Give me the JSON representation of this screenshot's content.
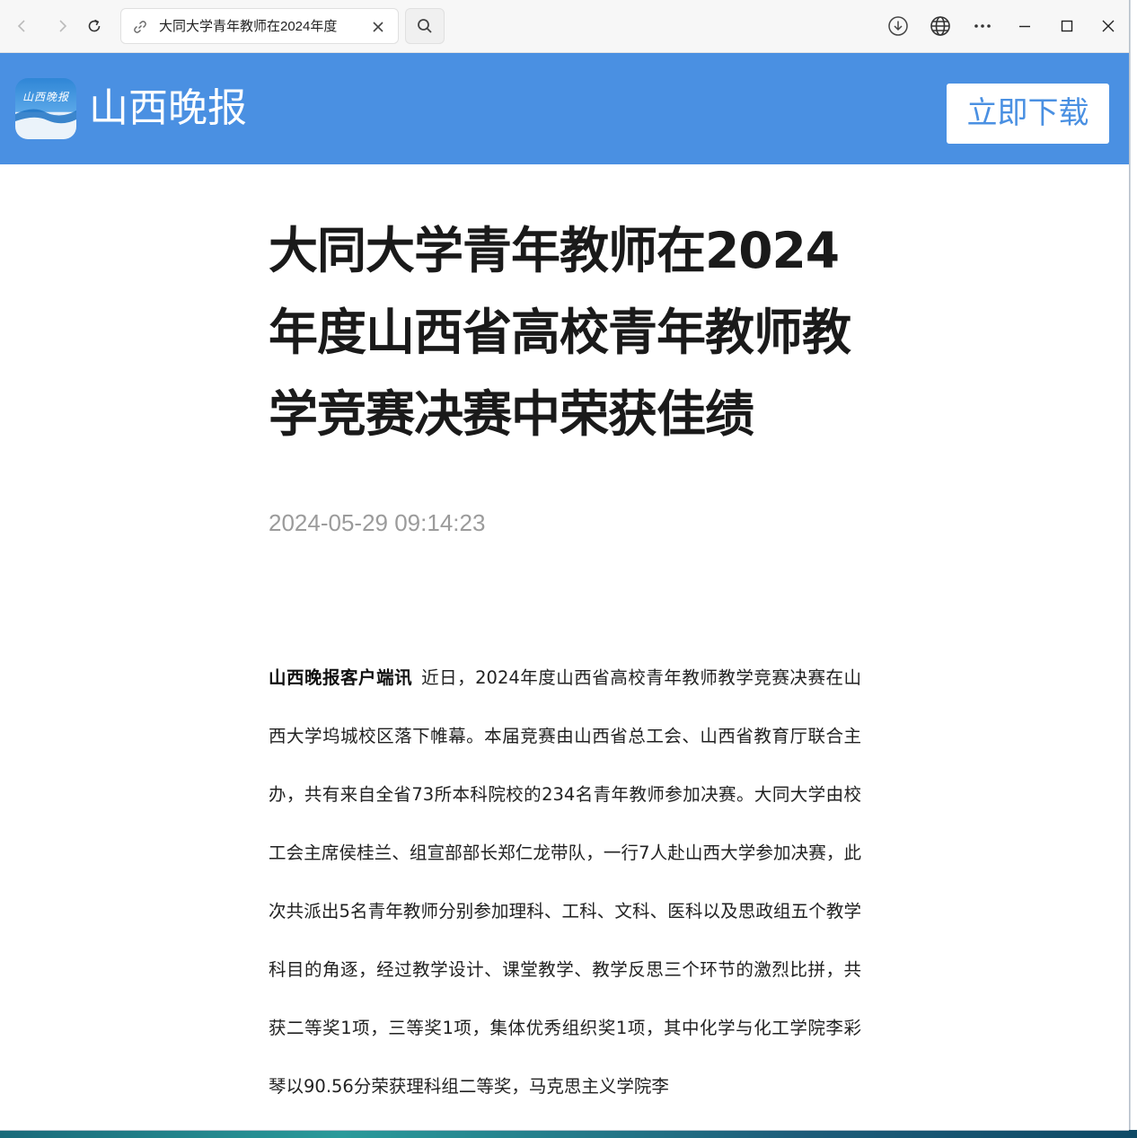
{
  "browser": {
    "tab_title": "大同大学青年教师在2024年度",
    "icons": {
      "back": "arrow-left-icon",
      "forward": "arrow-right-icon",
      "reload": "reload-icon",
      "tab_link": "link-icon",
      "tab_close": "close-icon",
      "search": "search-icon",
      "download": "download-icon",
      "translate": "globe-icon",
      "more": "more-icon",
      "minimize": "minimize-icon",
      "maximize": "maximize-icon",
      "close": "window-close-icon"
    }
  },
  "header": {
    "logo_text": "山西晚报",
    "site_name": "山西晚报",
    "download_label": "立即下载",
    "colors": {
      "background": "#4a90e2",
      "button_text": "#4a90e2"
    }
  },
  "article": {
    "title": "大同大学青年教师在2024年度山西省高校青年教师教学竞赛决赛中荣获佳绩",
    "time": "2024-05-29 09:14:23",
    "source": "山西晚报客户端讯",
    "body": "近日，2024年度山西省高校青年教师教学竞赛决赛在山西大学坞城校区落下帷幕。本届竞赛由山西省总工会、山西省教育厅联合主办，共有来自全省73所本科院校的234名青年教师参加决赛。大同大学由校工会主席侯桂兰、组宣部部长郑仁龙带队，一行7人赴山西大学参加决赛，此次共派出5名青年教师分别参加理科、工科、文科、医科以及思政组五个教学科目的角逐，经过教学设计、课堂教学、教学反思三个环节的激烈比拼，共获二等奖1项，三等奖1项，集体优秀组织奖1项，其中化学与化工学院李彩琴以90.56分荣获理科组二等奖，马克思主义学院李"
  }
}
